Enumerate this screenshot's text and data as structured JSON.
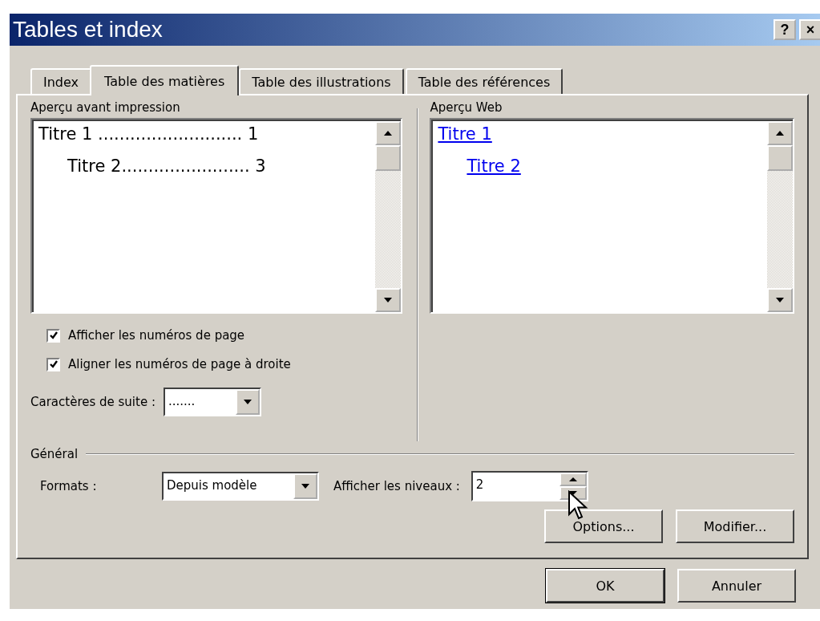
{
  "window": {
    "title": "Tables et index",
    "buttons": [
      "?",
      "×"
    ]
  },
  "tabs": [
    {
      "label": "Index",
      "selected": false
    },
    {
      "label": "Table des matières",
      "selected": true
    },
    {
      "label": "Table des illustrations",
      "selected": false
    },
    {
      "label": "Table des références",
      "selected": false
    }
  ],
  "print_preview": {
    "label": "Aperçu avant impression",
    "entries": [
      {
        "text": "Titre 1",
        "leader": "...........................",
        "page": "1",
        "children": [
          {
            "text": "Titre 2",
            "leader": "........................",
            "page": "3"
          }
        ]
      }
    ]
  },
  "web_preview": {
    "label": "Aperçu Web",
    "entries": [
      {
        "text": "Titre 1",
        "children": [
          {
            "text": "Titre 2"
          }
        ]
      }
    ]
  },
  "options": [
    {
      "label": "Afficher les numéros de page",
      "checked": true
    },
    {
      "label": "Aligner les numéros de page à droite",
      "checked": true
    }
  ],
  "leader_chars": {
    "label": "Caractères de suite :",
    "value": "......."
  },
  "general": {
    "label": "Général",
    "formats_label": "Formats :",
    "formats_value": "Depuis modèle",
    "levels_label": "Afficher les niveaux :",
    "levels_value": "2"
  },
  "panel_buttons": [
    "Options...",
    "Modifier..."
  ],
  "buttons": [
    "OK",
    "Annuler"
  ]
}
